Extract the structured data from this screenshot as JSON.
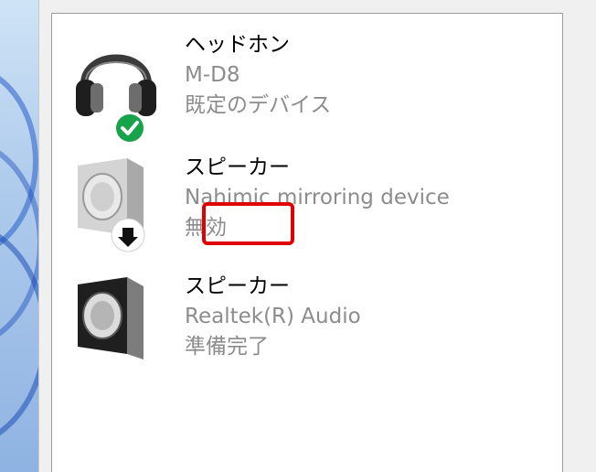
{
  "devices": [
    {
      "name": "ヘッドホン",
      "description": "M-D8",
      "status": "既定のデバイス",
      "icon": "headphones-icon",
      "badge": "checkmark-badge-icon",
      "badge_color": "#16a34a"
    },
    {
      "name": "スピーカー",
      "description": "Nahimic mirroring device",
      "status": "無効",
      "icon": "speaker-icon",
      "badge": "down-arrow-badge-icon",
      "state": "disabled"
    },
    {
      "name": "スピーカー",
      "description": "Realtek(R) Audio",
      "status": "準備完了",
      "icon": "speaker-icon"
    }
  ],
  "annotation": {
    "color": "#e00000"
  }
}
